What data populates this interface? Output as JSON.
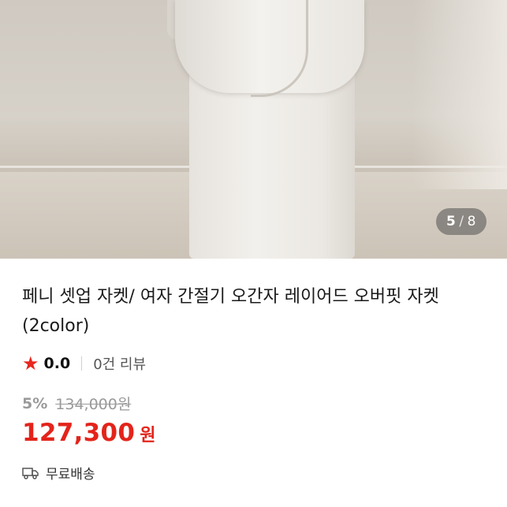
{
  "gallery": {
    "current": "5",
    "separator": "/",
    "total": "8"
  },
  "product": {
    "title": "페니 셋업 자켓/ 여자 간절기 오간자 레이어드 오버핏 자켓 (2color)",
    "rating": "0.0",
    "reviews": "0건 리뷰",
    "discount": "5%",
    "original_price": "134,000원",
    "price": "127,300",
    "currency": "원",
    "shipping": "무료배송"
  },
  "icons": {
    "rating": "star-icon",
    "shipping": "truck-icon"
  },
  "colors": {
    "accent": "#e3241b",
    "star": "#e8271f",
    "muted": "#9a9a9a"
  }
}
